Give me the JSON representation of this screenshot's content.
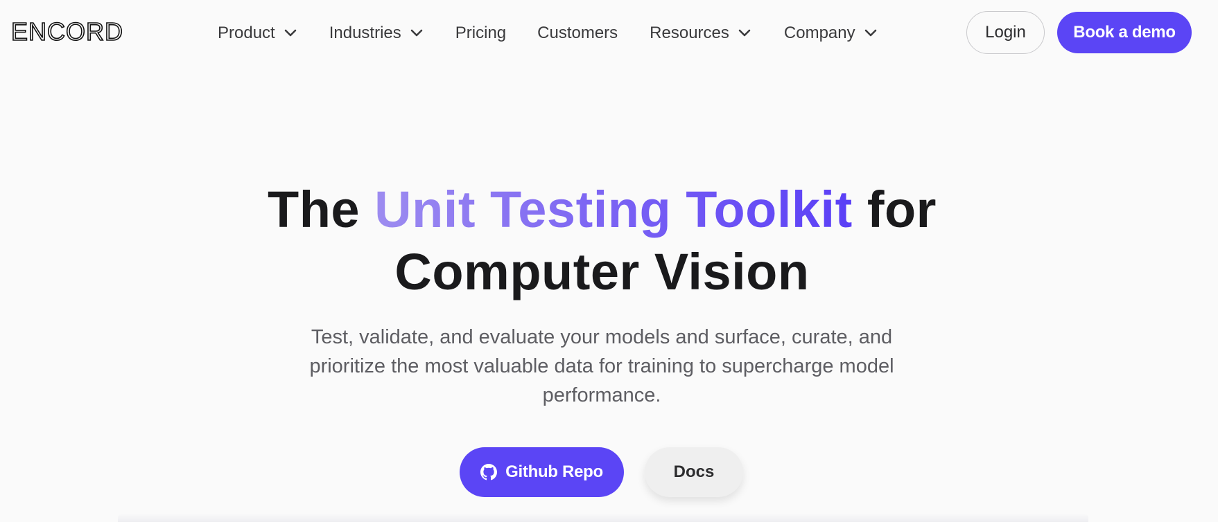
{
  "brand": {
    "logo_text": "ENCORD",
    "accent_color": "#5b45f5"
  },
  "nav": {
    "items": [
      {
        "label": "Product",
        "has_dropdown": true,
        "icon": "chevron-down-icon"
      },
      {
        "label": "Industries",
        "has_dropdown": true,
        "icon": "chevron-down-icon"
      },
      {
        "label": "Pricing",
        "has_dropdown": false
      },
      {
        "label": "Customers",
        "has_dropdown": false
      },
      {
        "label": "Resources",
        "has_dropdown": true,
        "icon": "chevron-down-icon"
      },
      {
        "label": "Company",
        "has_dropdown": true,
        "icon": "chevron-down-icon"
      }
    ],
    "login_label": "Login",
    "demo_label": "Book a demo"
  },
  "hero": {
    "title_prefix": "The",
    "title_highlight": "Unit Testing Toolkit",
    "title_suffix": "for",
    "title_line2": "Computer Vision",
    "highlight_gradient": [
      "#9d8cf0",
      "#5a3ff6"
    ],
    "subtitle": "Test, validate, and evaluate your models and surface, curate, and prioritize the most valuable data for training to supercharge model performance.",
    "primary_cta": {
      "label": "Github Repo",
      "icon": "github-icon"
    },
    "secondary_cta": {
      "label": "Docs"
    }
  }
}
